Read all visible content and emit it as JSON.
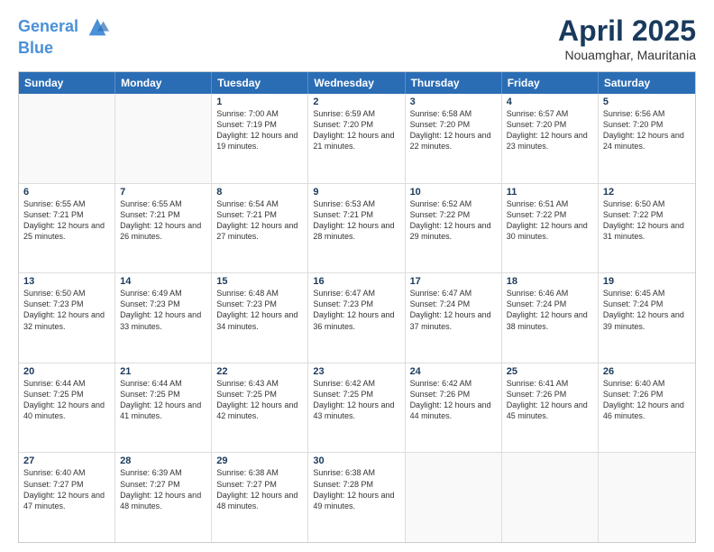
{
  "header": {
    "logo_line1": "General",
    "logo_line2": "Blue",
    "month": "April 2025",
    "location": "Nouamghar, Mauritania"
  },
  "days_of_week": [
    "Sunday",
    "Monday",
    "Tuesday",
    "Wednesday",
    "Thursday",
    "Friday",
    "Saturday"
  ],
  "weeks": [
    [
      {
        "day": "",
        "text": ""
      },
      {
        "day": "",
        "text": ""
      },
      {
        "day": "1",
        "text": "Sunrise: 7:00 AM\nSunset: 7:19 PM\nDaylight: 12 hours and 19 minutes."
      },
      {
        "day": "2",
        "text": "Sunrise: 6:59 AM\nSunset: 7:20 PM\nDaylight: 12 hours and 21 minutes."
      },
      {
        "day": "3",
        "text": "Sunrise: 6:58 AM\nSunset: 7:20 PM\nDaylight: 12 hours and 22 minutes."
      },
      {
        "day": "4",
        "text": "Sunrise: 6:57 AM\nSunset: 7:20 PM\nDaylight: 12 hours and 23 minutes."
      },
      {
        "day": "5",
        "text": "Sunrise: 6:56 AM\nSunset: 7:20 PM\nDaylight: 12 hours and 24 minutes."
      }
    ],
    [
      {
        "day": "6",
        "text": "Sunrise: 6:55 AM\nSunset: 7:21 PM\nDaylight: 12 hours and 25 minutes."
      },
      {
        "day": "7",
        "text": "Sunrise: 6:55 AM\nSunset: 7:21 PM\nDaylight: 12 hours and 26 minutes."
      },
      {
        "day": "8",
        "text": "Sunrise: 6:54 AM\nSunset: 7:21 PM\nDaylight: 12 hours and 27 minutes."
      },
      {
        "day": "9",
        "text": "Sunrise: 6:53 AM\nSunset: 7:21 PM\nDaylight: 12 hours and 28 minutes."
      },
      {
        "day": "10",
        "text": "Sunrise: 6:52 AM\nSunset: 7:22 PM\nDaylight: 12 hours and 29 minutes."
      },
      {
        "day": "11",
        "text": "Sunrise: 6:51 AM\nSunset: 7:22 PM\nDaylight: 12 hours and 30 minutes."
      },
      {
        "day": "12",
        "text": "Sunrise: 6:50 AM\nSunset: 7:22 PM\nDaylight: 12 hours and 31 minutes."
      }
    ],
    [
      {
        "day": "13",
        "text": "Sunrise: 6:50 AM\nSunset: 7:23 PM\nDaylight: 12 hours and 32 minutes."
      },
      {
        "day": "14",
        "text": "Sunrise: 6:49 AM\nSunset: 7:23 PM\nDaylight: 12 hours and 33 minutes."
      },
      {
        "day": "15",
        "text": "Sunrise: 6:48 AM\nSunset: 7:23 PM\nDaylight: 12 hours and 34 minutes."
      },
      {
        "day": "16",
        "text": "Sunrise: 6:47 AM\nSunset: 7:23 PM\nDaylight: 12 hours and 36 minutes."
      },
      {
        "day": "17",
        "text": "Sunrise: 6:47 AM\nSunset: 7:24 PM\nDaylight: 12 hours and 37 minutes."
      },
      {
        "day": "18",
        "text": "Sunrise: 6:46 AM\nSunset: 7:24 PM\nDaylight: 12 hours and 38 minutes."
      },
      {
        "day": "19",
        "text": "Sunrise: 6:45 AM\nSunset: 7:24 PM\nDaylight: 12 hours and 39 minutes."
      }
    ],
    [
      {
        "day": "20",
        "text": "Sunrise: 6:44 AM\nSunset: 7:25 PM\nDaylight: 12 hours and 40 minutes."
      },
      {
        "day": "21",
        "text": "Sunrise: 6:44 AM\nSunset: 7:25 PM\nDaylight: 12 hours and 41 minutes."
      },
      {
        "day": "22",
        "text": "Sunrise: 6:43 AM\nSunset: 7:25 PM\nDaylight: 12 hours and 42 minutes."
      },
      {
        "day": "23",
        "text": "Sunrise: 6:42 AM\nSunset: 7:25 PM\nDaylight: 12 hours and 43 minutes."
      },
      {
        "day": "24",
        "text": "Sunrise: 6:42 AM\nSunset: 7:26 PM\nDaylight: 12 hours and 44 minutes."
      },
      {
        "day": "25",
        "text": "Sunrise: 6:41 AM\nSunset: 7:26 PM\nDaylight: 12 hours and 45 minutes."
      },
      {
        "day": "26",
        "text": "Sunrise: 6:40 AM\nSunset: 7:26 PM\nDaylight: 12 hours and 46 minutes."
      }
    ],
    [
      {
        "day": "27",
        "text": "Sunrise: 6:40 AM\nSunset: 7:27 PM\nDaylight: 12 hours and 47 minutes."
      },
      {
        "day": "28",
        "text": "Sunrise: 6:39 AM\nSunset: 7:27 PM\nDaylight: 12 hours and 48 minutes."
      },
      {
        "day": "29",
        "text": "Sunrise: 6:38 AM\nSunset: 7:27 PM\nDaylight: 12 hours and 48 minutes."
      },
      {
        "day": "30",
        "text": "Sunrise: 6:38 AM\nSunset: 7:28 PM\nDaylight: 12 hours and 49 minutes."
      },
      {
        "day": "",
        "text": ""
      },
      {
        "day": "",
        "text": ""
      },
      {
        "day": "",
        "text": ""
      }
    ]
  ]
}
